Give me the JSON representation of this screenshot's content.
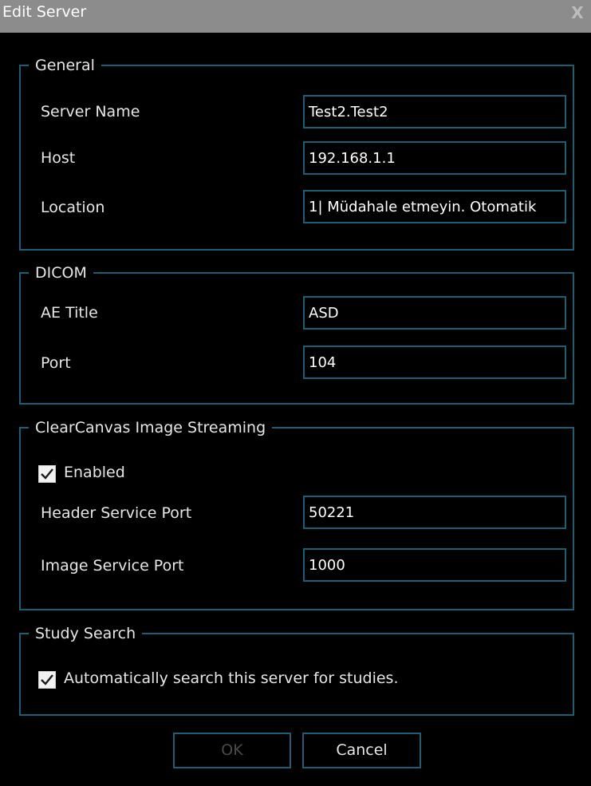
{
  "window": {
    "title": "Edit Server",
    "close_glyph": "X"
  },
  "general": {
    "legend": "General",
    "server_name_label": "Server Name",
    "server_name_value": "Test2.Test2",
    "host_label": "Host",
    "host_value": "192.168.1.1",
    "location_label": "Location",
    "location_value": "1| Müdahale etmeyin. Otomatik"
  },
  "dicom": {
    "legend": "DICOM",
    "ae_title_label": "AE Title",
    "ae_title_value": "ASD",
    "port_label": "Port",
    "port_value": "104"
  },
  "streaming": {
    "legend": "ClearCanvas Image Streaming",
    "enabled_label": "Enabled",
    "enabled_checked": true,
    "header_port_label": "Header Service Port",
    "header_port_value": "50221",
    "image_port_label": "Image Service Port",
    "image_port_value": "1000"
  },
  "study_search": {
    "legend": "Study Search",
    "auto_search_label": "Automatically search this server for studies.",
    "auto_search_checked": true
  },
  "buttons": {
    "ok_label": "OK",
    "cancel_label": "Cancel"
  },
  "colors": {
    "background": "#000000",
    "titlebar": "#8c8c8c",
    "border_accent": "#1b5f74",
    "text": "#e6e6e6"
  }
}
